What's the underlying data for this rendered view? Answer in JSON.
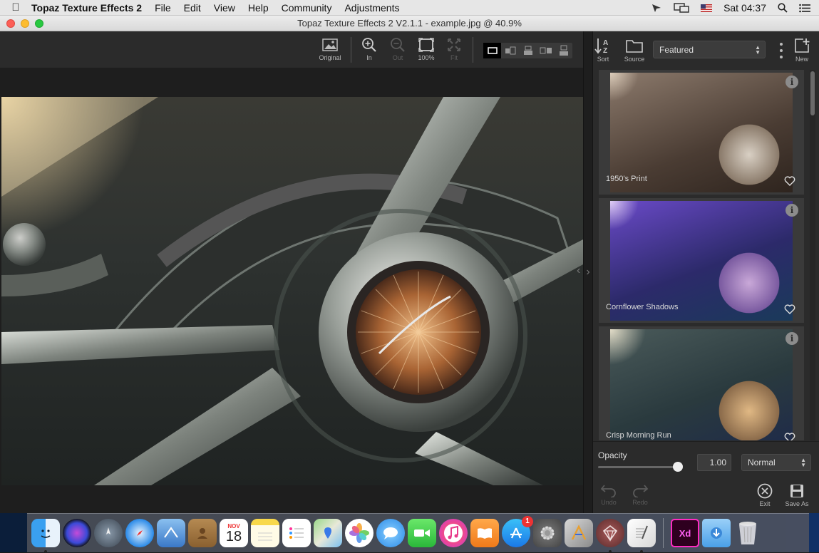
{
  "menubar": {
    "app_name": "Topaz Texture Effects 2",
    "items": [
      "File",
      "Edit",
      "View",
      "Help",
      "Community",
      "Adjustments"
    ],
    "clock": "Sat 04:37"
  },
  "window": {
    "title": "Topaz Texture Effects 2 V2.1.1 - example.jpg @ 40.9%"
  },
  "toolbar": {
    "original_label": "Original",
    "zoom_in_label": "In",
    "zoom_out_label": "Out",
    "actual_size_label": "100%",
    "fit_label": "Fit"
  },
  "panel": {
    "sort_label": "Sort",
    "source_label": "Source",
    "category_value": "Featured",
    "new_label": "New",
    "presets": [
      {
        "name": "1950's Print"
      },
      {
        "name": "Cornflower Shadows"
      },
      {
        "name": "Crisp Morning Run"
      }
    ],
    "opacity_label": "Opacity",
    "opacity_value": "1.00",
    "opacity_level": 1.0,
    "blend_mode": "Normal",
    "undo_label": "Undo",
    "redo_label": "Redo",
    "exit_label": "Exit",
    "save_as_label": "Save As"
  },
  "dock": {
    "calendar_month": "NOV",
    "calendar_day": "18",
    "app_store_badge": "1",
    "xd_label": "Xd",
    "apps": [
      "Finder",
      "Siri",
      "Launchpad",
      "Safari",
      "Mail",
      "Contacts",
      "Calendar",
      "Notes",
      "Reminders",
      "Maps",
      "Photos",
      "Messages",
      "FaceTime",
      "iTunes",
      "iBooks",
      "App Store",
      "System Preferences",
      "Instruments",
      "Topaz",
      "TextEdit",
      "Adobe XD",
      "Downloads",
      "Trash"
    ]
  }
}
